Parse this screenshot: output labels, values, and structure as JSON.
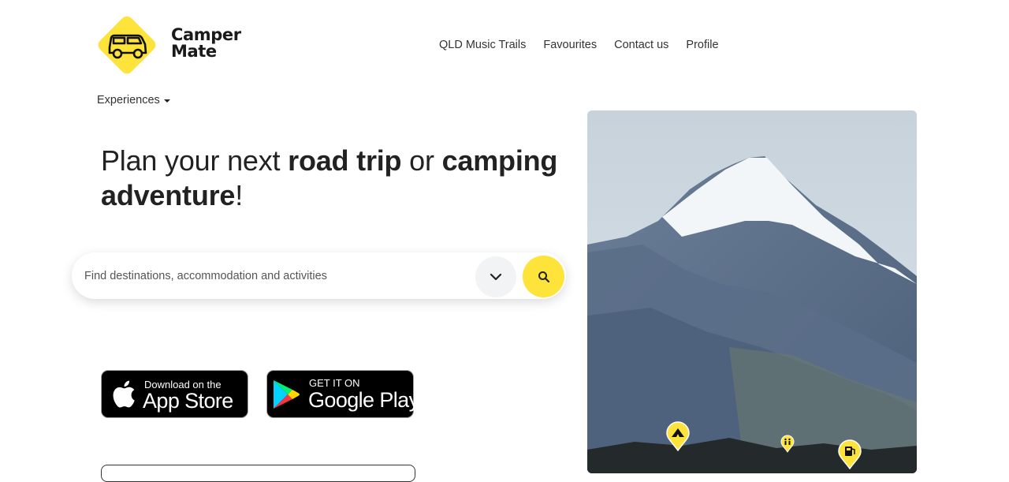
{
  "brand": {
    "line1": "Camper",
    "line2": "Mate",
    "color": "#fde33a"
  },
  "nav": {
    "items": [
      "QLD Music Trails",
      "Favourites",
      "Contact us",
      "Profile"
    ]
  },
  "experiences": {
    "label": "Experiences"
  },
  "headline": {
    "part1": "Plan your next ",
    "bold1": "road trip",
    "part2": " or ",
    "bold2": "camping adventure",
    "end": "!"
  },
  "search": {
    "placeholder": "Find destinations, accommodation and activities",
    "value": ""
  },
  "app_store": {
    "small": "Download on the",
    "big": "App Store"
  },
  "google_play": {
    "small": "GET IT ON",
    "big": "Google Play"
  },
  "hero": {
    "pins": [
      "camping-icon",
      "toilets-icon",
      "fuel-icon"
    ]
  }
}
